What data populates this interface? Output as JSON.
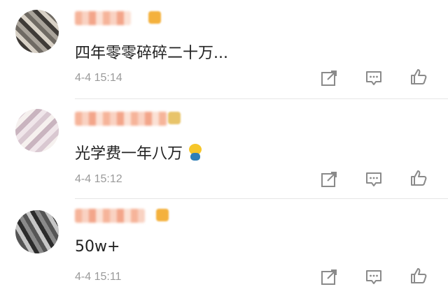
{
  "comments": [
    {
      "text": "四年零零碎碎二十万...",
      "time": "4-4 15:14",
      "has_emoji": false
    },
    {
      "text": "光学费一年八万",
      "time": "4-4 15:12",
      "has_emoji": true
    },
    {
      "text": "50w+",
      "time": "4-4 15:11",
      "has_emoji": false
    }
  ],
  "icons": {
    "share": "share-icon",
    "reply": "comment-icon",
    "like": "thumbs-up-icon"
  },
  "colors": {
    "text": "#222222",
    "meta": "#9a9a9a",
    "icon": "#8a8a8a",
    "divider": "#e6e6e6"
  }
}
